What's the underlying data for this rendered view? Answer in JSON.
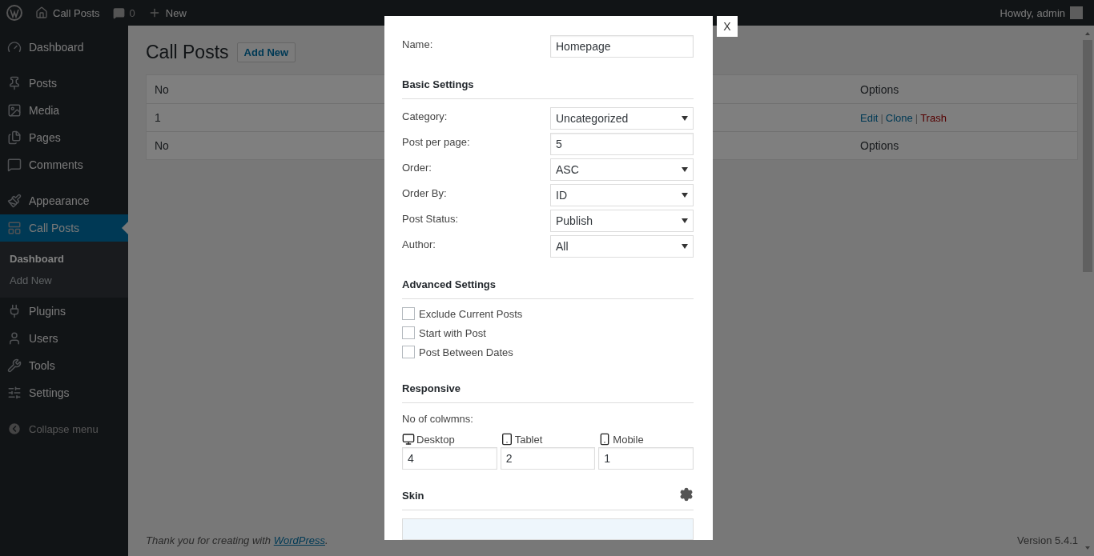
{
  "admin_bar": {
    "site": "Call Posts",
    "comments": "0",
    "new": "New",
    "greeting": "Howdy, admin"
  },
  "sidebar": {
    "groups": [
      [
        {
          "label": "Dashboard",
          "selected": false
        }
      ],
      [
        {
          "label": "Posts",
          "selected": false
        },
        {
          "label": "Media",
          "selected": false
        },
        {
          "label": "Pages",
          "selected": false
        },
        {
          "label": "Comments",
          "selected": false
        }
      ],
      [
        {
          "label": "Appearance",
          "selected": false
        },
        {
          "label": "Call Posts",
          "selected": true,
          "children": [
            {
              "label": "Dashboard",
              "selected": true
            },
            {
              "label": "Add New",
              "selected": false
            }
          ]
        },
        {
          "label": "Plugins",
          "selected": false
        },
        {
          "label": "Users",
          "selected": false
        },
        {
          "label": "Tools",
          "selected": false
        },
        {
          "label": "Settings",
          "selected": false
        }
      ]
    ],
    "collapse": "Collapse menu"
  },
  "page": {
    "title": "Call Posts",
    "add_new": "Add New",
    "table": {
      "separator": "|",
      "columns": [
        "No",
        "Options"
      ],
      "rows": [
        {
          "no": "1",
          "actions": [
            {
              "label": "Edit",
              "kind": "link"
            },
            {
              "label": "Clone",
              "kind": "link"
            },
            {
              "label": "Trash",
              "kind": "delete"
            }
          ]
        }
      ],
      "footer": [
        "No",
        "Options"
      ]
    }
  },
  "footer": {
    "before": "Thank you for creating with ",
    "link": "WordPress",
    "after": ".",
    "version": "Version 5.4.1"
  },
  "modal": {
    "close": "X",
    "name": {
      "label": "Name:",
      "value": "Homepage"
    },
    "basic": {
      "title": "Basic Settings",
      "fields": [
        {
          "label": "Category:",
          "value": "Uncategorized",
          "kind": "select"
        },
        {
          "label": "Post per page:",
          "value": "5",
          "kind": "text"
        },
        {
          "label": "Order:",
          "value": "ASC",
          "kind": "select"
        },
        {
          "label": "Order By:",
          "value": "ID",
          "kind": "select"
        },
        {
          "label": "Post Status:",
          "value": "Publish",
          "kind": "select"
        },
        {
          "label": "Author:",
          "value": "All",
          "kind": "select"
        }
      ]
    },
    "advanced": {
      "title": "Advanced Settings",
      "options": [
        {
          "label": "Exclude Current Posts",
          "checked": false
        },
        {
          "label": "Start with Post",
          "checked": false
        },
        {
          "label": "Post Between Dates",
          "checked": false
        }
      ]
    },
    "responsive": {
      "title": "Responsive",
      "label": "No of colwmns:",
      "devices": [
        {
          "label": "Desktop",
          "value": "4",
          "kind": "desktop"
        },
        {
          "label": "Tablet",
          "value": "2",
          "kind": "tablet"
        },
        {
          "label": "Mobile",
          "value": "1",
          "kind": "mobile"
        }
      ]
    },
    "skin": {
      "title": "Skin"
    }
  }
}
